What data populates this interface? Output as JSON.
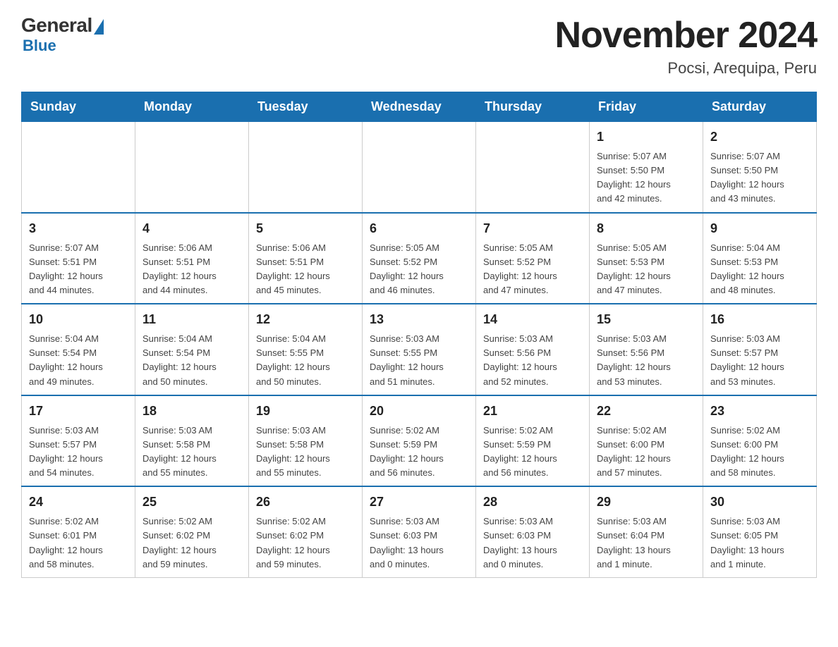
{
  "logo": {
    "general": "General",
    "blue": "Blue"
  },
  "title": "November 2024",
  "subtitle": "Pocsi, Arequipa, Peru",
  "weekdays": [
    "Sunday",
    "Monday",
    "Tuesday",
    "Wednesday",
    "Thursday",
    "Friday",
    "Saturday"
  ],
  "weeks": [
    [
      {
        "day": "",
        "info": ""
      },
      {
        "day": "",
        "info": ""
      },
      {
        "day": "",
        "info": ""
      },
      {
        "day": "",
        "info": ""
      },
      {
        "day": "",
        "info": ""
      },
      {
        "day": "1",
        "info": "Sunrise: 5:07 AM\nSunset: 5:50 PM\nDaylight: 12 hours\nand 42 minutes."
      },
      {
        "day": "2",
        "info": "Sunrise: 5:07 AM\nSunset: 5:50 PM\nDaylight: 12 hours\nand 43 minutes."
      }
    ],
    [
      {
        "day": "3",
        "info": "Sunrise: 5:07 AM\nSunset: 5:51 PM\nDaylight: 12 hours\nand 44 minutes."
      },
      {
        "day": "4",
        "info": "Sunrise: 5:06 AM\nSunset: 5:51 PM\nDaylight: 12 hours\nand 44 minutes."
      },
      {
        "day": "5",
        "info": "Sunrise: 5:06 AM\nSunset: 5:51 PM\nDaylight: 12 hours\nand 45 minutes."
      },
      {
        "day": "6",
        "info": "Sunrise: 5:05 AM\nSunset: 5:52 PM\nDaylight: 12 hours\nand 46 minutes."
      },
      {
        "day": "7",
        "info": "Sunrise: 5:05 AM\nSunset: 5:52 PM\nDaylight: 12 hours\nand 47 minutes."
      },
      {
        "day": "8",
        "info": "Sunrise: 5:05 AM\nSunset: 5:53 PM\nDaylight: 12 hours\nand 47 minutes."
      },
      {
        "day": "9",
        "info": "Sunrise: 5:04 AM\nSunset: 5:53 PM\nDaylight: 12 hours\nand 48 minutes."
      }
    ],
    [
      {
        "day": "10",
        "info": "Sunrise: 5:04 AM\nSunset: 5:54 PM\nDaylight: 12 hours\nand 49 minutes."
      },
      {
        "day": "11",
        "info": "Sunrise: 5:04 AM\nSunset: 5:54 PM\nDaylight: 12 hours\nand 50 minutes."
      },
      {
        "day": "12",
        "info": "Sunrise: 5:04 AM\nSunset: 5:55 PM\nDaylight: 12 hours\nand 50 minutes."
      },
      {
        "day": "13",
        "info": "Sunrise: 5:03 AM\nSunset: 5:55 PM\nDaylight: 12 hours\nand 51 minutes."
      },
      {
        "day": "14",
        "info": "Sunrise: 5:03 AM\nSunset: 5:56 PM\nDaylight: 12 hours\nand 52 minutes."
      },
      {
        "day": "15",
        "info": "Sunrise: 5:03 AM\nSunset: 5:56 PM\nDaylight: 12 hours\nand 53 minutes."
      },
      {
        "day": "16",
        "info": "Sunrise: 5:03 AM\nSunset: 5:57 PM\nDaylight: 12 hours\nand 53 minutes."
      }
    ],
    [
      {
        "day": "17",
        "info": "Sunrise: 5:03 AM\nSunset: 5:57 PM\nDaylight: 12 hours\nand 54 minutes."
      },
      {
        "day": "18",
        "info": "Sunrise: 5:03 AM\nSunset: 5:58 PM\nDaylight: 12 hours\nand 55 minutes."
      },
      {
        "day": "19",
        "info": "Sunrise: 5:03 AM\nSunset: 5:58 PM\nDaylight: 12 hours\nand 55 minutes."
      },
      {
        "day": "20",
        "info": "Sunrise: 5:02 AM\nSunset: 5:59 PM\nDaylight: 12 hours\nand 56 minutes."
      },
      {
        "day": "21",
        "info": "Sunrise: 5:02 AM\nSunset: 5:59 PM\nDaylight: 12 hours\nand 56 minutes."
      },
      {
        "day": "22",
        "info": "Sunrise: 5:02 AM\nSunset: 6:00 PM\nDaylight: 12 hours\nand 57 minutes."
      },
      {
        "day": "23",
        "info": "Sunrise: 5:02 AM\nSunset: 6:00 PM\nDaylight: 12 hours\nand 58 minutes."
      }
    ],
    [
      {
        "day": "24",
        "info": "Sunrise: 5:02 AM\nSunset: 6:01 PM\nDaylight: 12 hours\nand 58 minutes."
      },
      {
        "day": "25",
        "info": "Sunrise: 5:02 AM\nSunset: 6:02 PM\nDaylight: 12 hours\nand 59 minutes."
      },
      {
        "day": "26",
        "info": "Sunrise: 5:02 AM\nSunset: 6:02 PM\nDaylight: 12 hours\nand 59 minutes."
      },
      {
        "day": "27",
        "info": "Sunrise: 5:03 AM\nSunset: 6:03 PM\nDaylight: 13 hours\nand 0 minutes."
      },
      {
        "day": "28",
        "info": "Sunrise: 5:03 AM\nSunset: 6:03 PM\nDaylight: 13 hours\nand 0 minutes."
      },
      {
        "day": "29",
        "info": "Sunrise: 5:03 AM\nSunset: 6:04 PM\nDaylight: 13 hours\nand 1 minute."
      },
      {
        "day": "30",
        "info": "Sunrise: 5:03 AM\nSunset: 6:05 PM\nDaylight: 13 hours\nand 1 minute."
      }
    ]
  ]
}
